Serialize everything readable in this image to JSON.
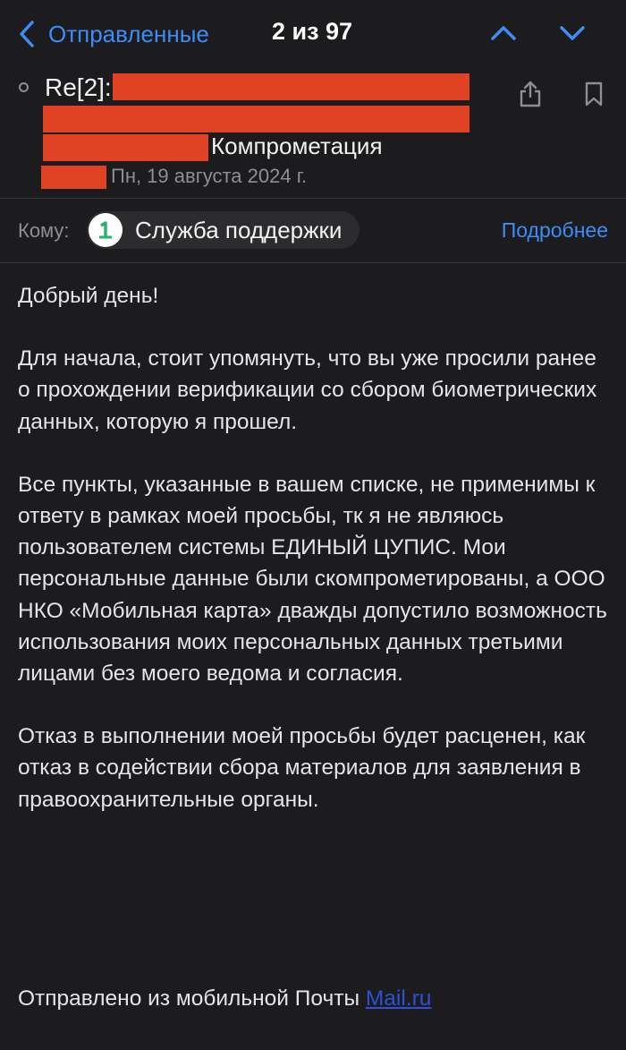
{
  "nav": {
    "back_label": "Отправленные",
    "counter": "2 из 97",
    "back_icon": "chevron-left-icon",
    "prev_icon": "chevron-up-icon",
    "next_icon": "chevron-down-icon"
  },
  "header": {
    "subject_prefix": "Re[2]:",
    "subject_end": "Компрометация",
    "date": "Пн, 19 августа 2024 г.",
    "share_icon": "share-icon",
    "bookmark_icon": "bookmark-icon",
    "redaction_color": "#e14224"
  },
  "recipients": {
    "to_label": "Кому:",
    "name": "Служба поддержки",
    "details_label": "Подробнее"
  },
  "body": {
    "paragraphs": [
      "Добрый день!",
      "Для начала, стоит упомянуть, что вы уже просили ранее о прохождении верификации со сбором биометрических данных, которую я прошел.",
      "Все пункты, указанные в вашем списке, не применимы к ответу в рамках моей просьбы, тк я не являюсь пользователем системы ЕДИНЫЙ ЦУПИС. Мои персональные данные были скомпрометированы, а ООО НКО «Мобильная карта» дважды допустило возможность использования моих персональных данных третьими лицами без моего ведома и согласия.",
      "Отказ в выполнении моей просьбы будет расценен, как отказ в содействии сбора материалов для заявления в правоохранительные органы."
    ]
  },
  "signature": {
    "text": "Отправлено из мобильной Почты ",
    "link": "Mail.ru"
  },
  "colors": {
    "background": "#1c1c1e",
    "accent": "#3e8cf6",
    "secondary_text": "#8e8e93"
  }
}
